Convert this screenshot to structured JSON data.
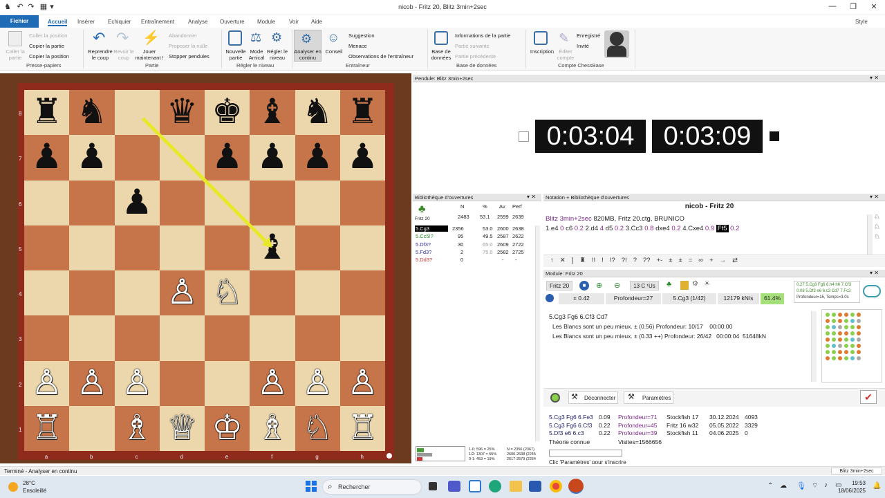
{
  "window": {
    "title": "nicob - Fritz 20, Blitz 3min+2sec",
    "style_label": "Style"
  },
  "menu": {
    "file": "Fichier",
    "tabs": [
      "Accueil",
      "Insérer",
      "Echiquier",
      "Entraînement",
      "Analyse",
      "Ouverture",
      "Module",
      "Voir",
      "Aide"
    ]
  },
  "ribbon": {
    "clipboard": {
      "paste": "Coller la partie",
      "copy_pos": "Coller la position",
      "copy_game": "Copier la partie",
      "copy_pos2": "Copier la position",
      "group": "Presse-papiers"
    },
    "game": {
      "takeback": "Reprendre le coup",
      "forward": "Revoir le coup",
      "play_now": "Jouer maintenant !",
      "resign": "Abandonner",
      "offer_draw": "Proposer la nulle",
      "stop_clocks": "Stopper pendules",
      "group": "Partie"
    },
    "level": {
      "new_game": "Nouvelle partie",
      "friend": "Mode Amical",
      "set_level": "Régler le niveau",
      "group": "Régler le niveau"
    },
    "trainer": {
      "analyze": "Analyser en continu",
      "advice": "Conseil",
      "suggestion": "Suggestion",
      "threat": "Menace",
      "observations": "Observations de l'entraîneur",
      "group": "Entraîneur"
    },
    "db": {
      "base": "Base de données",
      "info": "Informations de la partie",
      "next": "Partie suivante",
      "prev": "Partie précédente",
      "group": "Base de données"
    },
    "account": {
      "register": "Inscription",
      "edit": "Éditer compte",
      "registered": "Enregistré",
      "guest": "Invité",
      "group": "Compte ChessBase"
    }
  },
  "board": {
    "ranks": [
      "8",
      "7",
      "6",
      "5",
      "4",
      "3",
      "2",
      "1"
    ],
    "files": [
      "a",
      "b",
      "c",
      "d",
      "e",
      "f",
      "g",
      "h"
    ],
    "position": [
      [
        "br",
        "bn",
        "",
        "bq",
        "bk",
        "bb",
        "bn",
        "br"
      ],
      [
        "bp",
        "bp",
        "",
        "",
        "bp",
        "bp",
        "bp",
        "bp"
      ],
      [
        "",
        "",
        "bp",
        "",
        "",
        "",
        "",
        ""
      ],
      [
        "",
        "",
        "",
        "",
        "",
        "bb",
        "",
        ""
      ],
      [
        "",
        "",
        "",
        "wp",
        "wn",
        "",
        "",
        ""
      ],
      [
        "",
        "",
        "",
        "",
        "",
        "",
        "",
        ""
      ],
      [
        "wp",
        "wp",
        "wp",
        "",
        "",
        "wp",
        "wp",
        "wp"
      ],
      [
        "wr",
        "",
        "wb",
        "wq",
        "wk",
        "wb",
        "wn",
        "wr"
      ]
    ],
    "arrow": {
      "from": "c8",
      "to": "f5",
      "color": "#e8e82a"
    }
  },
  "clock": {
    "header": "Pendule: Blitz 3min+2sec",
    "white": "0:03:04",
    "black": "0:03:09"
  },
  "book": {
    "header": "Bibliothèque d'ouvertures",
    "engine": "Fritz 20",
    "columns": [
      "N",
      "%",
      "Av",
      "Perf"
    ],
    "total": [
      "2483",
      "53.1",
      "2599",
      "2639"
    ],
    "rows": [
      {
        "move": "5.Cg3",
        "n": "2356",
        "pct": "53.0",
        "av": "2600",
        "perf": "2638"
      },
      {
        "move": "5.Cc5!?",
        "n": "95",
        "pct": "49.5",
        "av": "2587",
        "perf": "2622"
      },
      {
        "move": "5.Df3?",
        "n": "30",
        "pct": "65.0",
        "av": "2609",
        "perf": "2722"
      },
      {
        "move": "5.Fd3?",
        "n": "2",
        "pct": "75.0",
        "av": "2582",
        "perf": "2725"
      },
      {
        "move": "5.Dd3?",
        "n": "0",
        "pct": "",
        "av": "-",
        "perf": "-"
      }
    ],
    "stats": [
      "1-0: 596 = 25%",
      "1/2: 1307 = 55%",
      "0-1: 453 = 19%",
      "N = 2356 (2367)",
      "2600-2638 (2245",
      "2617-2579 (2254"
    ]
  },
  "notation": {
    "header": "Notation + Bibliothèque d'ouvertures",
    "title": "nicob - Fritz 20",
    "event": "Blitz 3min+2sec",
    "event_rest": "820MB, Fritz 20.ctg, BRUNICO",
    "moves": [
      [
        "1.e4",
        "0"
      ],
      [
        "c6",
        "0.2"
      ],
      [
        "2.d4",
        "4"
      ],
      [
        "d5",
        "0.2"
      ],
      [
        "3.Cc3",
        "0.8"
      ],
      [
        "dxe4",
        "0.2"
      ],
      [
        "4.Cxe4",
        "0.9"
      ],
      [
        "Ff5",
        "0.2"
      ]
    ],
    "toolbar": [
      "↑",
      "✕",
      "]",
      "♜",
      "!!",
      "!",
      "!?",
      "?!",
      "?",
      "??",
      "+-",
      "±",
      "±",
      "=",
      "∞",
      "+",
      "→",
      "⇄"
    ]
  },
  "module": {
    "header": "Module: Fritz 20",
    "engine": "Fritz 20",
    "cores": "13 C ¹Us",
    "eval": "± 0.42",
    "depth": "Profondeur=27",
    "move": "5.Cg3 (1/42)",
    "speed": "12179 kN/s",
    "pct": "61.4%",
    "mini": [
      "0.27 5.Cg3 Fg6 6.h4 h6 7.Cf3",
      "0.08 5.Df3 e6 6.c3 Cd7 7.Fc3",
      "Profondeur=15, Temps=3.0s"
    ],
    "pv": "5.Cg3 Fg6 6.Cf3 Cd7",
    "lines": [
      "Les Blancs sont un peu mieux. ± (0.56) Profondeur: 10/17    00:00:00",
      "Les Blancs sont un peu mieux. ± (0.33 ++) Profondeur: 26/42   00:00:04  51648kN"
    ]
  },
  "cloud": {
    "disconnect": "Déconnecter",
    "params": "Paramètres",
    "rows": [
      {
        "line": "5.Cg3 Fg6 6.Fe3",
        "eval": "0.09",
        "depth": "Profondeur=71",
        "engine": "Stockfish 17",
        "date": "30.12.2024",
        "n": "4093"
      },
      {
        "line": "5.Cg3 Fg6 6.Cf3",
        "eval": "0.22",
        "depth": "Profondeur=45",
        "engine": "Fritz 16 w32",
        "date": "05.05.2022",
        "n": "3329"
      },
      {
        "line": "5.Df3 e6 6.c3",
        "eval": "0.22",
        "depth": "Profondeur=39",
        "engine": "Stockfish 11",
        "date": "04.06.2025",
        "n": "0"
      }
    ],
    "theory": "Théorie connue",
    "visits": "Visites=1566656",
    "hint": "Clic 'Paramètres' pour s'inscrire"
  },
  "status": {
    "text": "Terminé - Analyser en continu",
    "right": "Blitz 3min+2sec"
  },
  "taskbar": {
    "temp": "28°C",
    "weather": "Ensoleillé",
    "search": "Rechercher",
    "time": "19:53",
    "date": "18/06/2025"
  }
}
